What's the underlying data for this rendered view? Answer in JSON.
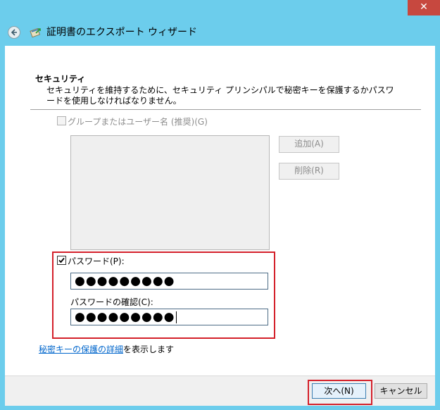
{
  "window": {
    "close_glyph": "✕",
    "title": "証明書のエクスポート ウィザード",
    "back_icon": "back-arrow-icon",
    "wizard_icon": "certificate-icon"
  },
  "security": {
    "heading": "セキュリティ",
    "description": "セキュリティを維持するために、セキュリティ プリンシパルで秘密キーを保護するかパスワードを使用しなければなりません。"
  },
  "group": {
    "checkbox_label": "グループまたはユーザー名 (推奨)(G)",
    "add_button": "追加(A)",
    "remove_button": "削除(R)"
  },
  "password": {
    "checkbox_label": "パスワード(P):",
    "checked": true,
    "value": "●●●●●●●●●",
    "confirm_label": "パスワードの確認(C):",
    "confirm_value": "●●●●●●●●●"
  },
  "details": {
    "link_text": "秘密キーの保護の詳細",
    "suffix": "を表示します"
  },
  "footer": {
    "next_button": "次へ(N)",
    "cancel_button": "キャンセル"
  },
  "colors": {
    "highlight": "#d4202a",
    "title_bar": "#6ccdec",
    "close_button": "#c7483f"
  }
}
